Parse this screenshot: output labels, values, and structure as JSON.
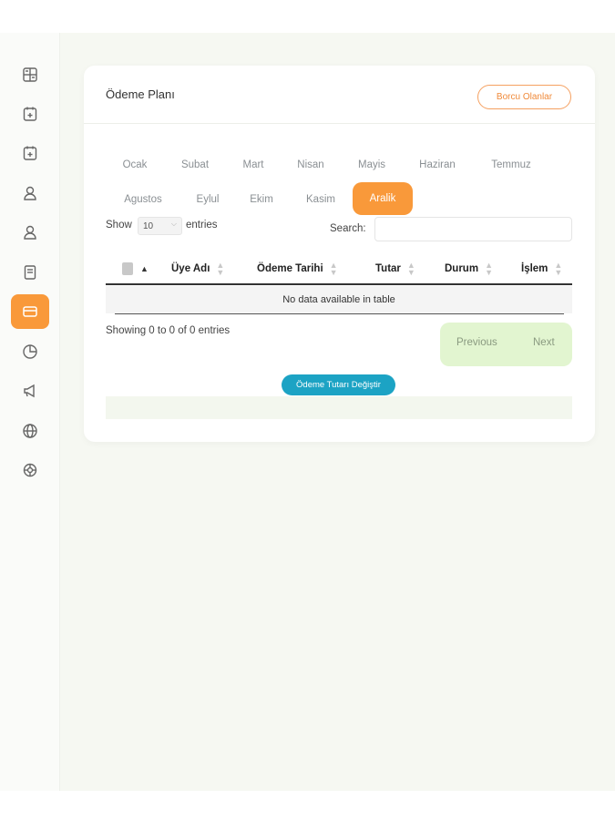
{
  "colors": {
    "accent": "#f9993a",
    "teal": "#1ca3c4",
    "pager_bg": "#e2f5d0",
    "page_bg": "#f6f8f2"
  },
  "sidebar": {
    "items": [
      {
        "icon": "grid-icon",
        "active": false
      },
      {
        "icon": "calendar-icon",
        "active": false
      },
      {
        "icon": "calendar-icon",
        "active": false
      },
      {
        "icon": "user-icon",
        "active": false
      },
      {
        "icon": "user-icon",
        "active": false
      },
      {
        "icon": "document-icon",
        "active": false
      },
      {
        "icon": "card-icon",
        "active": true
      },
      {
        "icon": "pie-chart-icon",
        "active": false
      },
      {
        "icon": "megaphone-icon",
        "active": false
      },
      {
        "icon": "globe-icon",
        "active": false
      },
      {
        "icon": "settings-icon",
        "active": false
      }
    ]
  },
  "card": {
    "title": "Ödeme Planı",
    "debt_button": "Borcu Olanlar"
  },
  "months": [
    {
      "label": "Ocak"
    },
    {
      "label": "Subat"
    },
    {
      "label": "Mart"
    },
    {
      "label": "Nisan"
    },
    {
      "label": "Mayis"
    },
    {
      "label": "Haziran"
    },
    {
      "label": "Temmuz"
    },
    {
      "label": "Agustos"
    },
    {
      "label": "Eylul"
    },
    {
      "label": "Ekim"
    },
    {
      "label": "Kasim"
    },
    {
      "label": "Aralik",
      "active": true
    }
  ],
  "table_controls": {
    "show_label": "Show",
    "length_value": "10",
    "entries_label": "entries",
    "search_label": "Search:",
    "search_value": ""
  },
  "table": {
    "columns": [
      "Üye Adı",
      "Ödeme Tarihi",
      "Tutar",
      "Durum",
      "İşlem"
    ],
    "empty_message": "No data available in table",
    "info": "Showing 0 to 0 of 0 entries",
    "previous": "Previous",
    "next": "Next"
  },
  "change_button": "Ödeme Tutarı Değiştir"
}
